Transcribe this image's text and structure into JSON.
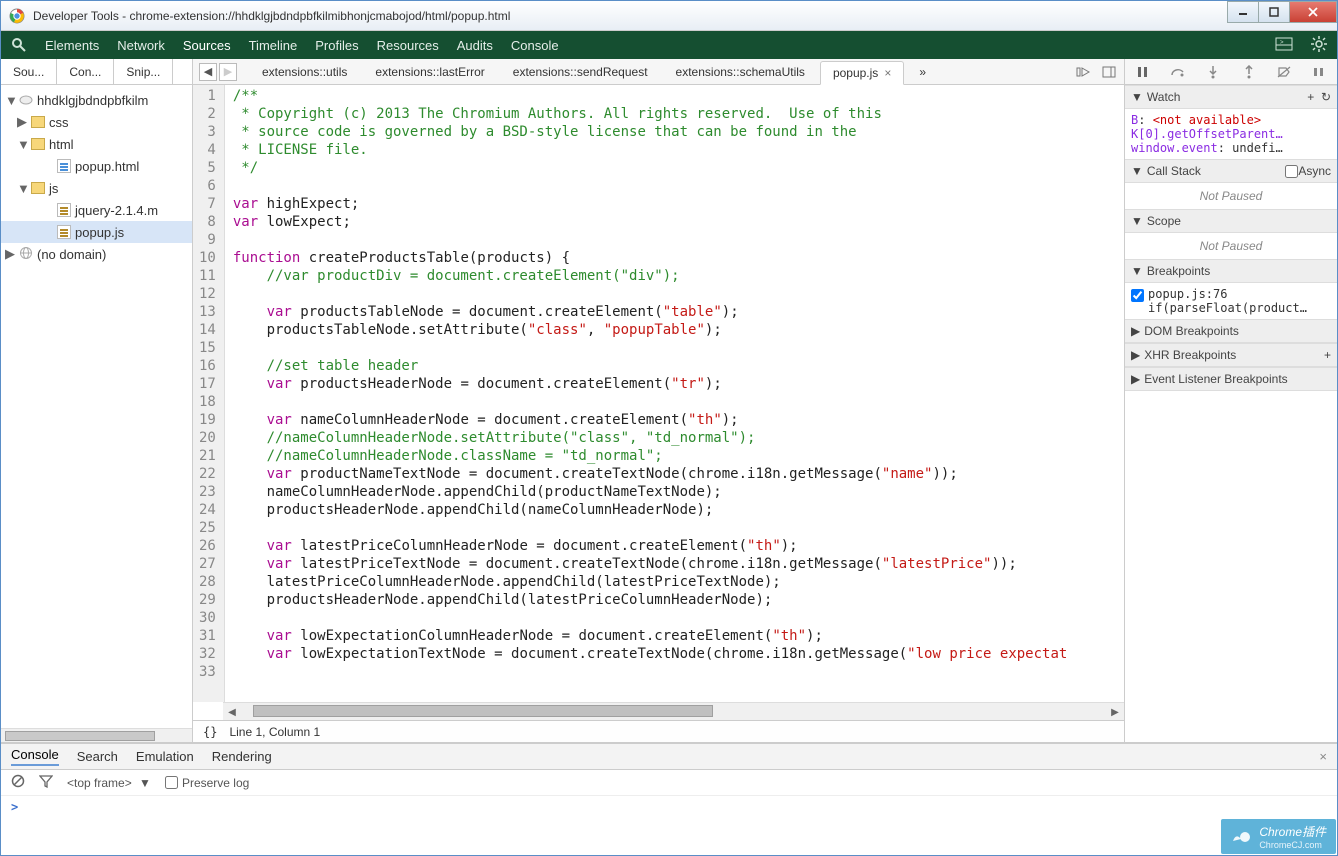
{
  "window": {
    "title": "Developer Tools - chrome-extension://hhdklgjbdndpbfkilmibhonjcmabojod/html/popup.html"
  },
  "mainTabs": [
    "Elements",
    "Network",
    "Sources",
    "Timeline",
    "Profiles",
    "Resources",
    "Audits",
    "Console"
  ],
  "sidebar": {
    "tabs": [
      "Sou...",
      "Con...",
      "Snip..."
    ],
    "tree": {
      "origin": "hhdklgjbdndpbfkilm",
      "folders": {
        "css": "css",
        "html": "html",
        "js": "js"
      },
      "files": {
        "popupHtml": "popup.html",
        "jquery": "jquery-2.1.4.m",
        "popupJs": "popup.js"
      },
      "noDomain": "(no domain)"
    }
  },
  "editorTabs": {
    "t1": "extensions::utils",
    "t2": "extensions::lastError",
    "t3": "extensions::sendRequest",
    "t4": "extensions::schemaUtils",
    "t5": "popup.js",
    "more": "»"
  },
  "code": {
    "l1": "/**",
    "l2": " * Copyright (c) 2013 The Chromium Authors. All rights reserved.  Use of this",
    "l3": " * source code is governed by a BSD-style license that can be found in the",
    "l4": " * LICENSE file.",
    "l5": " */",
    "l7a": "var",
    "l7b": " highExpect;",
    "l8a": "var",
    "l8b": " lowExpect;",
    "l10a": "function",
    "l10b": " createProductsTable(products) {",
    "l11": "    //var productDiv = document.createElement(\"div\");",
    "l13a": "    var",
    "l13b": " productsTableNode = document.createElement(",
    "l13s": "\"table\"",
    "l13c": ");",
    "l14a": "    productsTableNode.setAttribute(",
    "l14s1": "\"class\"",
    "l14m": ", ",
    "l14s2": "\"popupTable\"",
    "l14c": ");",
    "l16": "    //set table header",
    "l17a": "    var",
    "l17b": " productsHeaderNode = document.createElement(",
    "l17s": "\"tr\"",
    "l17c": ");",
    "l19a": "    var",
    "l19b": " nameColumnHeaderNode = document.createElement(",
    "l19s": "\"th\"",
    "l19c": ");",
    "l20": "    //nameColumnHeaderNode.setAttribute(\"class\", \"td_normal\");",
    "l21": "    //nameColumnHeaderNode.className = \"td_normal\";",
    "l22a": "    var",
    "l22b": " productNameTextNode = document.createTextNode(chrome.i18n.getMessage(",
    "l22s": "\"name\"",
    "l22c": "));",
    "l23": "    nameColumnHeaderNode.appendChild(productNameTextNode);",
    "l24": "    productsHeaderNode.appendChild(nameColumnHeaderNode);",
    "l26a": "    var",
    "l26b": " latestPriceColumnHeaderNode = document.createElement(",
    "l26s": "\"th\"",
    "l26c": ");",
    "l27a": "    var",
    "l27b": " latestPriceTextNode = document.createTextNode(chrome.i18n.getMessage(",
    "l27s": "\"latestPrice\"",
    "l27c": "));",
    "l28": "    latestPriceColumnHeaderNode.appendChild(latestPriceTextNode);",
    "l29": "    productsHeaderNode.appendChild(latestPriceColumnHeaderNode);",
    "l31a": "    var",
    "l31b": " lowExpectationColumnHeaderNode = document.createElement(",
    "l31s": "\"th\"",
    "l31c": ");",
    "l32a": "    var",
    "l32b": " lowExpectationTextNode = document.createTextNode(chrome.i18n.getMessage(",
    "l32s": "\"low price expectat",
    "l32c": ""
  },
  "status": {
    "pos": "Line 1, Column 1",
    "braces": "{}"
  },
  "watch": {
    "title": "Watch",
    "l1a": "B",
    "l1b": ": ",
    "l1c": "<not available>",
    "l2": "K[0].getOffsetParent…",
    "l3a": "window.event",
    "l3b": ": undefi…"
  },
  "callStack": {
    "title": "Call Stack",
    "async": "Async",
    "notPaused": "Not Paused"
  },
  "scope": {
    "title": "Scope",
    "notPaused": "Not Paused"
  },
  "breakpoints": {
    "title": "Breakpoints",
    "file": "popup.js:76",
    "cond": "if(parseFloat(product…"
  },
  "domBp": "DOM Breakpoints",
  "xhrBp": "XHR Breakpoints",
  "evtBp": "Event Listener Breakpoints",
  "drawer": {
    "tabs": [
      "Console",
      "Search",
      "Emulation",
      "Rendering"
    ],
    "topFrame": "<top frame>",
    "preserve": "Preserve log",
    "prompt": ">"
  },
  "watermark": {
    "main": "Chrome插件",
    "sub": "ChromeCJ.com"
  }
}
